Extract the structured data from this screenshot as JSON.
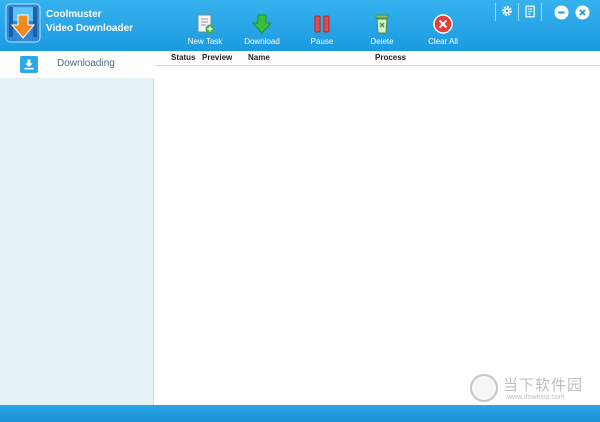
{
  "app": {
    "name_line1": "Coolmuster",
    "name_line2": "Video Downloader"
  },
  "toolbar": {
    "new_task": "New Task",
    "download": "Download",
    "pause": "Pause",
    "delete": "Delete",
    "clear_all": "Clear All"
  },
  "window_controls": {
    "settings_icon": "gear-icon",
    "register_icon": "register-icon",
    "minimize_icon": "minimize-icon",
    "close_icon": "close-icon"
  },
  "sidebar": {
    "items": [
      {
        "label": "Downloading",
        "icon": "download-icon"
      }
    ]
  },
  "table": {
    "columns": [
      "Status",
      "Preview",
      "Name",
      "Process"
    ],
    "rows": []
  },
  "watermark": {
    "text_cn": "当下软件园",
    "url": "www.downxia.com"
  },
  "colors": {
    "titlebar": "#1c9ae0",
    "sidebar_bg": "#e4f1f7",
    "statusbar": "#1a8fd4"
  }
}
